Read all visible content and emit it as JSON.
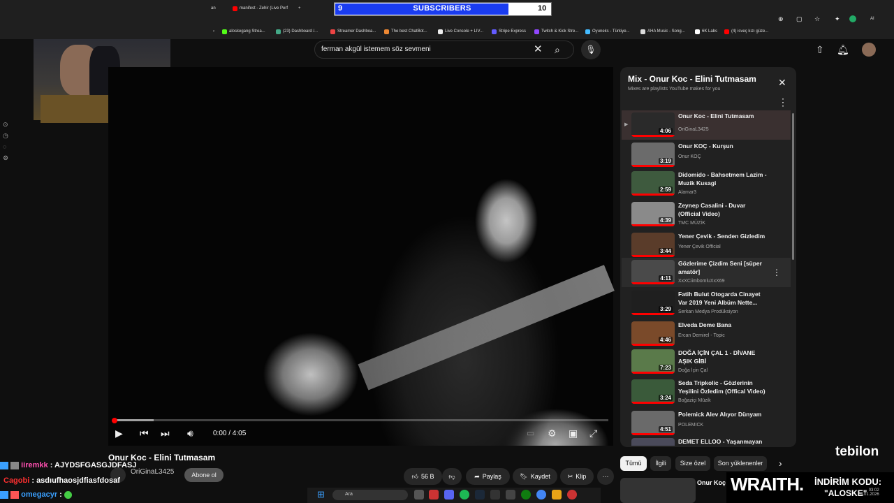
{
  "browser": {
    "tabs": [
      "an",
      "manifest - Zehir (Live Perf",
      "+"
    ],
    "bookmarks": [
      "aloskegang Strea...",
      "(23) Dashboard /...",
      "Streamer Dashboa...",
      "The best ChatBot...",
      "Live Console + LIV...",
      "Stripe Express",
      "Twitch & Kick Stre...",
      "Oyuneks - Türkiye...",
      "AHA Music - Song...",
      "6K Labs",
      "(4) isveç kızı güze..."
    ],
    "ai_label": "AI"
  },
  "subscribers": {
    "current": "9",
    "label": "SUBSCRIBERS",
    "goal": "10",
    "progress": 0.9
  },
  "search": {
    "query": "ferman akgül istemem söz sevmeni"
  },
  "player": {
    "time": "0:00 / 4:05",
    "progress": 0.0,
    "buffered": 0.08
  },
  "video": {
    "title": "Onur Koc - Elini Tutmasam",
    "channel": "OriGinaL3425",
    "subscribe_label": "Abone ol"
  },
  "actions": {
    "likes": "56 B",
    "share": "Paylaş",
    "save": "Kaydet",
    "clip": "Klip"
  },
  "playlist": {
    "title": "Mix - Onur Koc - Elini Tutmasam",
    "subtitle": "Mixes are playlists YouTube makes for you",
    "items": [
      {
        "title": "Onur Koc - Elini Tutmasam",
        "channel": "OriGinaL3425",
        "duration": "4:06",
        "color": "#2a2a2a"
      },
      {
        "title": "Onur KOÇ - Kurşun",
        "channel": "Onur KOÇ",
        "duration": "3:19",
        "color": "#6b6b6b"
      },
      {
        "title": "Didomido - Bahsetmem Lazim - Muzik Kusagi",
        "channel": "Alamar3",
        "duration": "2:59",
        "color": "#3e5a3e"
      },
      {
        "title": "Zeynep Casalini - Duvar (Official Video)",
        "channel": "TMC MÜZİK",
        "duration": "4:39",
        "color": "#8a8a8a"
      },
      {
        "title": "Yener Çevik - Senden Gizledim",
        "channel": "Yener Çevik Official",
        "duration": "3:44",
        "color": "#5a3c2a"
      },
      {
        "title": "Gözlerime Çizdim Seni [süper amatör]",
        "channel": "XxXCiimbomluXxX69",
        "duration": "4:11",
        "color": "#4a4a4a"
      },
      {
        "title": "Fatih Bulut Otogarda Cinayet Var 2019 Yeni Albüm Nette...",
        "channel": "Serkan Medya Prodüksiyon",
        "duration": "3:29",
        "color": "#1f1f1f"
      },
      {
        "title": "Elveda Deme Bana",
        "channel": "Ercan Demirel - Topic",
        "duration": "4:46",
        "color": "#7a4a2a"
      },
      {
        "title": "DOĞA İÇİN ÇAL 1 - DİVANE AŞIK GİBİ",
        "channel": "Doğa İçin Çal",
        "duration": "7:23",
        "color": "#5a7a4a"
      },
      {
        "title": "Seda Tripkolic - Gözlerinin Yeşilini Özledim (Offical Video)",
        "channel": "Boğaziçi Müzik",
        "duration": "3:24",
        "color": "#3a5a3a"
      },
      {
        "title": "Polemick Alev Alıyor Dünyam",
        "channel": "POLEMICK",
        "duration": "4:51",
        "color": "#6a6a6a"
      },
      {
        "title": "DEMET ELLOO - Yaşanmayan",
        "channel": "",
        "duration": "",
        "color": "#4a4a5a"
      }
    ]
  },
  "chips": [
    "Tümü",
    "İlgili",
    "Size özel",
    "Son yüklenenler"
  ],
  "next_video": {
    "title": "Onur Koç - ..."
  },
  "chat": [
    {
      "user": "iiremkk",
      "message": "AJYDSFGASGJDFASJ",
      "color": "#ff4fb0"
    },
    {
      "user": "Cagobi",
      "message": "asdıufhaosjdfiasfdosaf",
      "color": "#ff3030"
    },
    {
      "user": "omegacyr",
      "message": "",
      "color": "#3aa0ff"
    }
  ],
  "overlay": {
    "brand": "tebilon",
    "sponsor": "WRAITH.",
    "promo_label": "İNDİRİM KODU:",
    "promo_code": "\"ALOSKE\""
  },
  "taskbar": {
    "search": "Ara",
    "time": "03:02",
    "date": "4.01.2026"
  }
}
